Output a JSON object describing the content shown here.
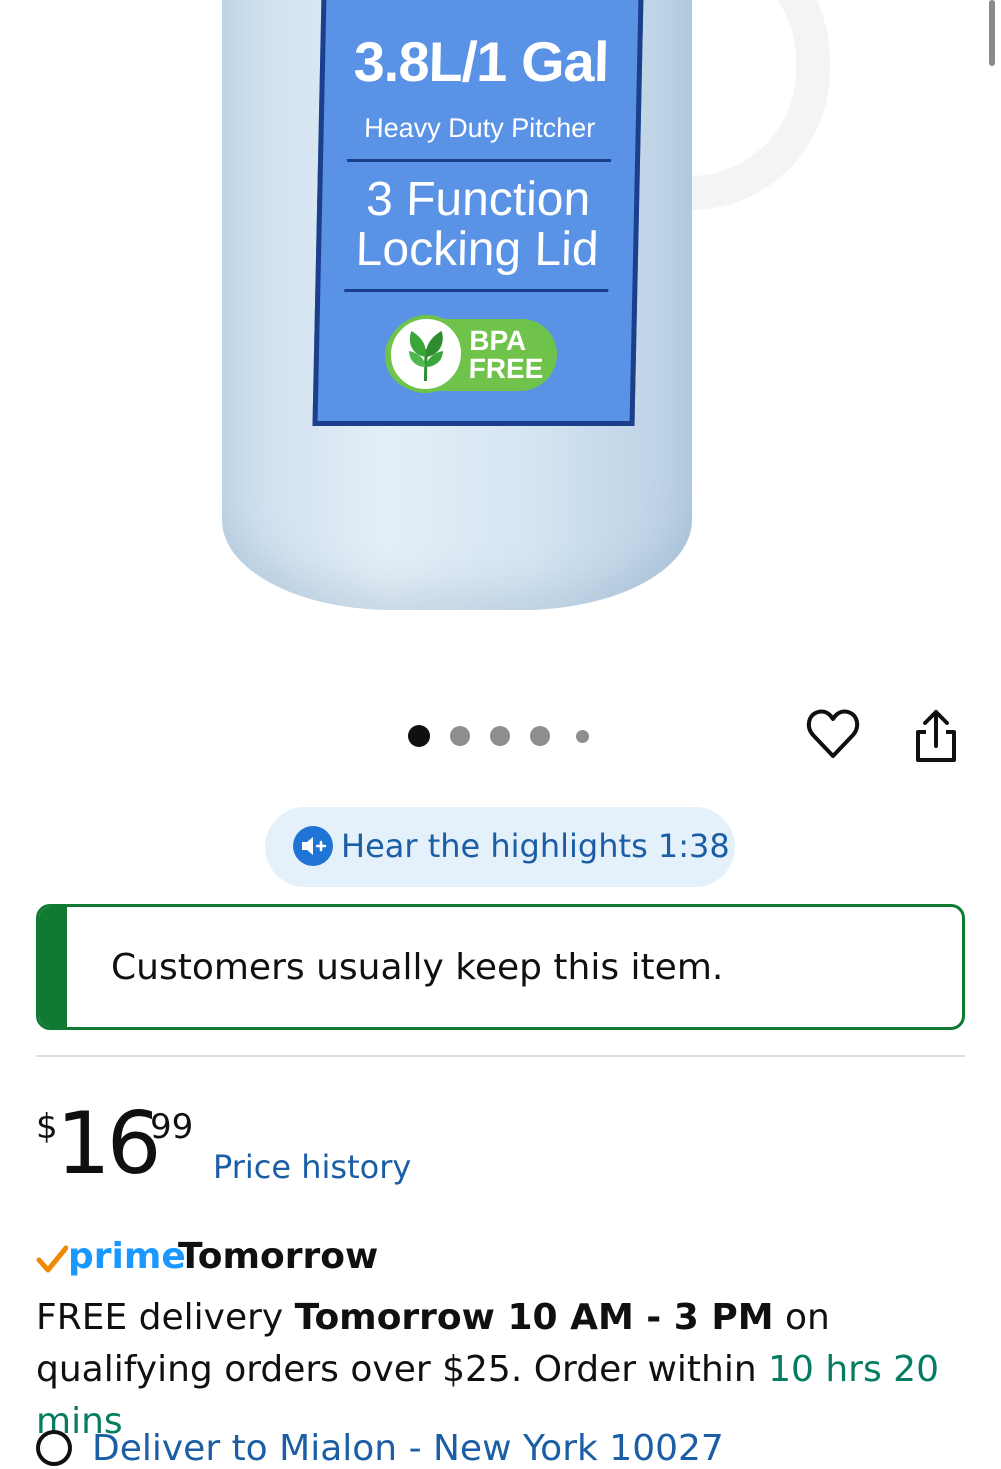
{
  "product_image": {
    "capacity_label": "3.8L/1 Gal",
    "subtitle": "Heavy Duty Pitcher",
    "feature_line1": "3 Function",
    "feature_line2": "Locking Lid",
    "bpa_line1": "BPA",
    "bpa_line2": "FREE",
    "label_color": "#5a93e6",
    "badge_color": "#6fc24a"
  },
  "carousel": {
    "total_images": 5,
    "active_index": 0
  },
  "actions": {
    "wishlist_icon": "heart-outline-icon",
    "share_icon": "share-icon"
  },
  "highlights": {
    "label": "Hear the highlights 1:38",
    "icon": "speaker-icon"
  },
  "keep_banner": {
    "text": "Customers usually keep this item.",
    "accent_color": "#107a33"
  },
  "price": {
    "symbol": "$",
    "whole": "16",
    "fraction": "99",
    "history_link": "Price history"
  },
  "prime": {
    "word": "prime",
    "day": "Tomorrow",
    "brand_color": "#1a98ff"
  },
  "delivery": {
    "prefix": "FREE delivery ",
    "window": "Tomorrow 10 AM - 3 PM",
    "middle": " on qualifying orders over $25. Order within ",
    "countdown": "10 hrs 20 mins",
    "countdown_color": "#067d62"
  },
  "deliver_to": {
    "text": "Deliver to Mialon - New York 10027"
  }
}
